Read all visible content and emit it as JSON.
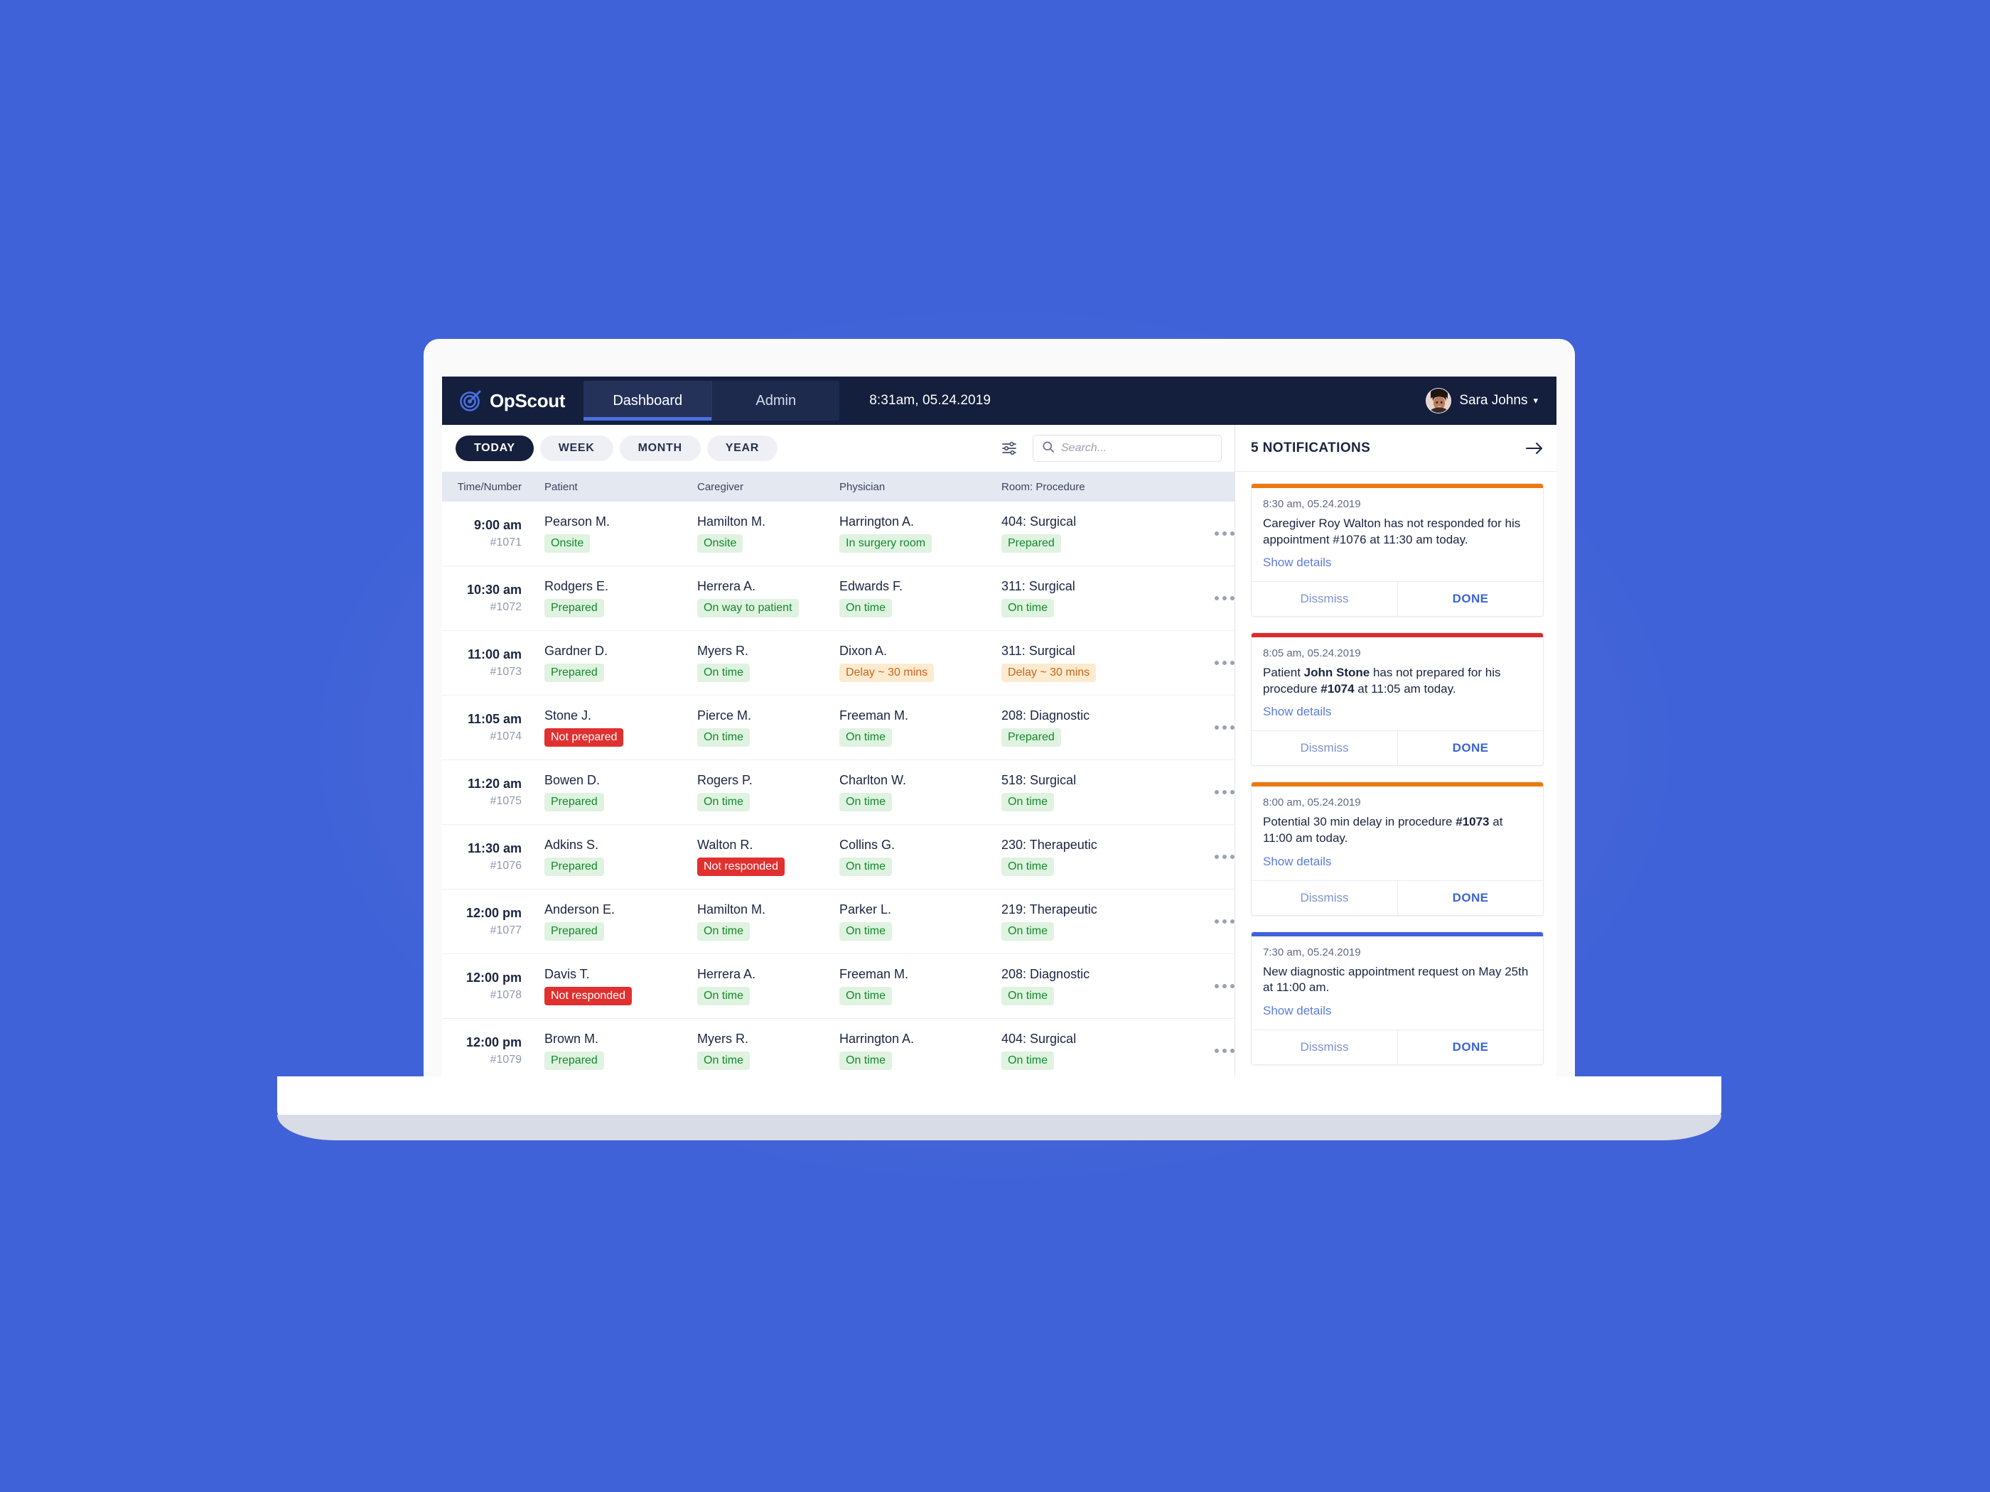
{
  "brand": {
    "name": "OpScout",
    "logo_icon": "target-scope-icon",
    "logo_color": "#4b6fe0"
  },
  "topnav": {
    "tabs": [
      {
        "label": "Dashboard",
        "active": true
      },
      {
        "label": "Admin",
        "active": false
      }
    ],
    "datetime": "8:31am, 05.24.2019",
    "user": {
      "name": "Sara Johns",
      "caret": "▾",
      "avatar_icon": "user-avatar"
    }
  },
  "toolbar": {
    "range_pills": [
      {
        "label": "TODAY",
        "active": true
      },
      {
        "label": "WEEK",
        "active": false
      },
      {
        "label": "MONTH",
        "active": false
      },
      {
        "label": "YEAR",
        "active": false
      }
    ],
    "filter_icon": "sliders-filter-icon",
    "search": {
      "placeholder": "Search...",
      "value": "",
      "icon": "search-icon"
    }
  },
  "table": {
    "columns": [
      "Time/Number",
      "Patient",
      "Caregiver",
      "Physician",
      "Room: Procedure"
    ],
    "row_menu_icon": "more-options-icon",
    "rows": [
      {
        "time": "9:00 am",
        "number": "#1071",
        "patient": {
          "name": "Pearson M.",
          "status": "Onsite",
          "tone": "green"
        },
        "caregiver": {
          "name": "Hamilton M.",
          "status": "Onsite",
          "tone": "green"
        },
        "physician": {
          "name": "Harrington A.",
          "status": "In surgery room",
          "tone": "green"
        },
        "room": {
          "name": "404: Surgical",
          "status": "Prepared",
          "tone": "green"
        }
      },
      {
        "time": "10:30 am",
        "number": "#1072",
        "patient": {
          "name": "Rodgers E.",
          "status": "Prepared",
          "tone": "green"
        },
        "caregiver": {
          "name": "Herrera A.",
          "status": "On way to patient",
          "tone": "green"
        },
        "physician": {
          "name": "Edwards F.",
          "status": "On time",
          "tone": "green"
        },
        "room": {
          "name": "311: Surgical",
          "status": "On time",
          "tone": "green"
        }
      },
      {
        "time": "11:00 am",
        "number": "#1073",
        "patient": {
          "name": "Gardner D.",
          "status": "Prepared",
          "tone": "green"
        },
        "caregiver": {
          "name": "Myers R.",
          "status": "On time",
          "tone": "green"
        },
        "physician": {
          "name": "Dixon A.",
          "status": "Delay ~ 30 mins",
          "tone": "amber"
        },
        "room": {
          "name": "311: Surgical",
          "status": "Delay ~ 30 mins",
          "tone": "amber"
        }
      },
      {
        "time": "11:05 am",
        "number": "#1074",
        "patient": {
          "name": "Stone J.",
          "status": "Not prepared",
          "tone": "red"
        },
        "caregiver": {
          "name": "Pierce M.",
          "status": "On time",
          "tone": "green"
        },
        "physician": {
          "name": "Freeman M.",
          "status": "On time",
          "tone": "green"
        },
        "room": {
          "name": "208: Diagnostic",
          "status": "Prepared",
          "tone": "green"
        }
      },
      {
        "time": "11:20 am",
        "number": "#1075",
        "patient": {
          "name": "Bowen D.",
          "status": "Prepared",
          "tone": "green"
        },
        "caregiver": {
          "name": "Rogers P.",
          "status": "On time",
          "tone": "green"
        },
        "physician": {
          "name": "Charlton W.",
          "status": "On time",
          "tone": "green"
        },
        "room": {
          "name": "518: Surgical",
          "status": "On time",
          "tone": "green"
        }
      },
      {
        "time": "11:30 am",
        "number": "#1076",
        "patient": {
          "name": "Adkins S.",
          "status": "Prepared",
          "tone": "green"
        },
        "caregiver": {
          "name": "Walton R.",
          "status": "Not responded",
          "tone": "red"
        },
        "physician": {
          "name": "Collins G.",
          "status": "On time",
          "tone": "green"
        },
        "room": {
          "name": "230: Therapeutic",
          "status": "On time",
          "tone": "green"
        }
      },
      {
        "time": "12:00 pm",
        "number": "#1077",
        "patient": {
          "name": "Anderson E.",
          "status": "Prepared",
          "tone": "green"
        },
        "caregiver": {
          "name": "Hamilton M.",
          "status": "On time",
          "tone": "green"
        },
        "physician": {
          "name": "Parker L.",
          "status": "On time",
          "tone": "green"
        },
        "room": {
          "name": "219: Therapeutic",
          "status": "On time",
          "tone": "green"
        }
      },
      {
        "time": "12:00 pm",
        "number": "#1078",
        "patient": {
          "name": "Davis T.",
          "status": "Not responded",
          "tone": "red"
        },
        "caregiver": {
          "name": "Herrera A.",
          "status": "On time",
          "tone": "green"
        },
        "physician": {
          "name": "Freeman M.",
          "status": "On time",
          "tone": "green"
        },
        "room": {
          "name": "208: Diagnostic",
          "status": "On time",
          "tone": "green"
        }
      },
      {
        "time": "12:00 pm",
        "number": "#1079",
        "patient": {
          "name": "Brown M.",
          "status": "Prepared",
          "tone": "green"
        },
        "caregiver": {
          "name": "Myers R.",
          "status": "On time",
          "tone": "green"
        },
        "physician": {
          "name": "Harrington A.",
          "status": "On time",
          "tone": "green"
        },
        "room": {
          "name": "404: Surgical",
          "status": "On time",
          "tone": "green"
        }
      }
    ]
  },
  "notifications": {
    "title": "5 NOTIFICATIONS",
    "expand_icon": "arrow-right-icon",
    "dismiss_label": "Dissmiss",
    "done_label": "DONE",
    "details_label": "Show details",
    "items": [
      {
        "accent": "#ec7a10",
        "time": "8:30 am, 05.24.2019",
        "text_parts": [
          {
            "t": "Caregiver Roy Walton has not responded for his appointment #1076 at 11:30 am today.",
            "bold": false
          }
        ]
      },
      {
        "accent": "#d92d2d",
        "time": "8:05 am, 05.24.2019",
        "text_parts": [
          {
            "t": "Patient ",
            "bold": false
          },
          {
            "t": "John Stone",
            "bold": true
          },
          {
            "t": " has not prepared for his procedure ",
            "bold": false
          },
          {
            "t": "#1074",
            "bold": true
          },
          {
            "t": " at 11:05 am today.",
            "bold": false
          }
        ]
      },
      {
        "accent": "#ec7a10",
        "time": "8:00 am, 05.24.2019",
        "text_parts": [
          {
            "t": "Potential 30 min delay in procedure ",
            "bold": false
          },
          {
            "t": "#1073",
            "bold": true
          },
          {
            "t": " at 11:00 am today.",
            "bold": false
          }
        ]
      },
      {
        "accent": "#4062d8",
        "time": "7:30 am, 05.24.2019",
        "text_parts": [
          {
            "t": "New diagnostic appointment request on May 25th at 11:00 am.",
            "bold": false
          }
        ]
      }
    ]
  },
  "colors": {
    "page_background": "#4062d8",
    "nav_background": "#131f3d",
    "accent_blue": "#4b6fe0",
    "status_green_bg": "#dff3e0",
    "status_green_fg": "#14892c",
    "status_red_bg": "#e0302f",
    "status_amber_bg": "#fdebcf",
    "status_amber_fg": "#c9641a"
  }
}
